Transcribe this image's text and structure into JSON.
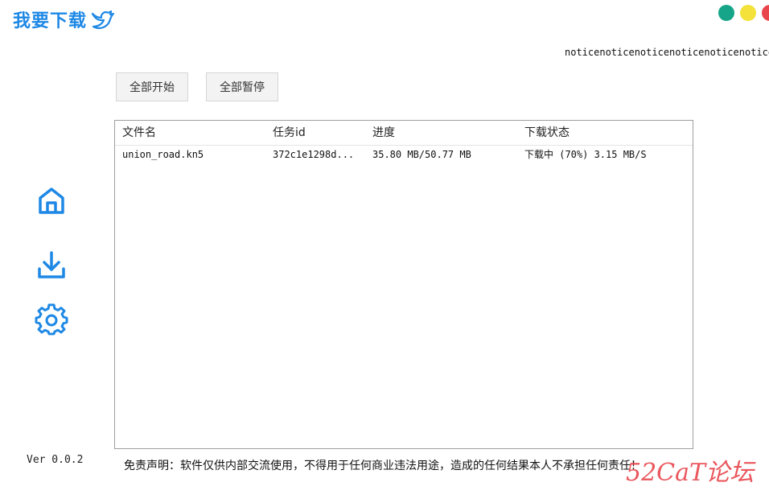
{
  "app": {
    "title": "我要下载",
    "version": "Ver 0.0.2"
  },
  "window_controls": {
    "colors": [
      "#17a589",
      "#f4e13a",
      "#e8454c"
    ]
  },
  "notice": "noticenoticenoticenoticenoticenoticenoti",
  "toolbar": {
    "start_all": "全部开始",
    "pause_all": "全部暂停"
  },
  "table": {
    "headers": [
      "文件名",
      "任务id",
      "进度",
      "下载状态"
    ],
    "rows": [
      [
        "union_road.kn5",
        "372c1e1298d...",
        "35.80 MB/50.77 MB",
        "下载中 (70%) 3.15 MB/S"
      ]
    ]
  },
  "sidebar": {
    "icons": [
      "home-icon",
      "download-icon",
      "gear-icon"
    ],
    "accent": "#1e88e5"
  },
  "footer": {
    "disclaimer": "免责声明：软件仅供内部交流使用，不得用于任何商业违法用途，造成的任何结果本人不承担任何责任！",
    "watermark": "52CaT论坛"
  }
}
